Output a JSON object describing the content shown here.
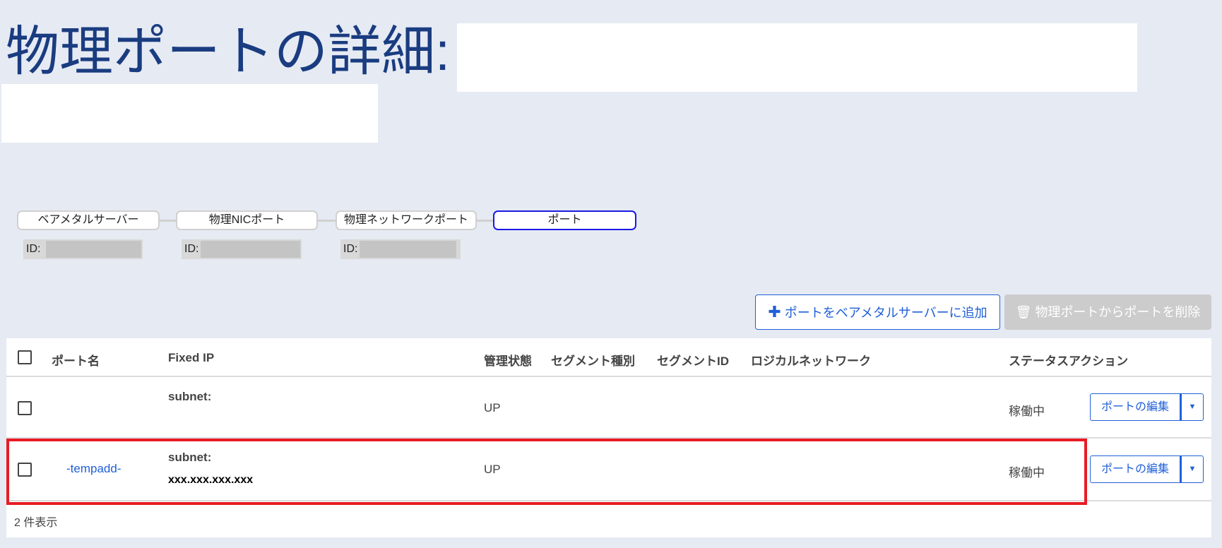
{
  "page": {
    "title": "物理ポートの詳細:"
  },
  "breadcrumb": [
    {
      "label": "ベアメタルサーバー",
      "id_label": "ID:"
    },
    {
      "label": "物理NICポート",
      "id_label": "ID:"
    },
    {
      "label": "物理ネットワークポート",
      "id_label": "ID:"
    },
    {
      "label": "ポート",
      "active": true
    }
  ],
  "toolbar": {
    "add_icon": "plus-icon",
    "add_label": "ポートをベアメタルサーバーに追加",
    "delete_icon": "trash-icon",
    "delete_label": "物理ポートからポートを削除"
  },
  "table": {
    "headers": [
      "ポート名",
      "Fixed IP",
      "管理状態",
      "セグメント種別",
      "セグメントID",
      "ロジカルネットワーク",
      "ステータス",
      "アクション"
    ],
    "rows": [
      {
        "name": "",
        "fixed_ip_label": "subnet:",
        "fixed_ip": "",
        "admin_state": "UP",
        "status": "稼働中",
        "edit_label": "ポートの編集"
      },
      {
        "name": "-tempadd-",
        "fixed_ip_label": "subnet:",
        "fixed_ip": "xxx.xxx.xxx.xxx",
        "admin_state": "UP",
        "status": "稼働中",
        "edit_label": "ポートの編集",
        "highlighted": true
      }
    ],
    "footer": "2 件表示"
  },
  "colors": {
    "accent": "#2060d8",
    "title": "#1a3c80",
    "highlight": "#e81c24",
    "active_crumb": "#1a1ae6"
  }
}
